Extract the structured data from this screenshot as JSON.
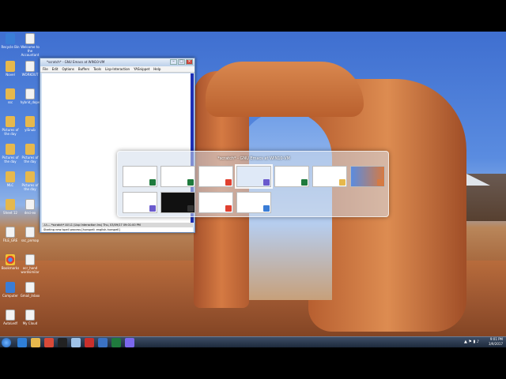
{
  "desktop": {
    "icons": [
      {
        "label": "Recycle Bin",
        "kind": "blue"
      },
      {
        "label": "Welcome to the\nAccountant",
        "kind": "doc"
      },
      {
        "label": "Novel",
        "kind": "folder"
      },
      {
        "label": "WORKOUT",
        "kind": "doc"
      },
      {
        "label": "ssc",
        "kind": "folder"
      },
      {
        "label": "hybrid_dope",
        "kind": "doc"
      },
      {
        "label": "Pictures of\nthe day",
        "kind": "folder"
      },
      {
        "label": "yiSnub",
        "kind": "folder"
      },
      {
        "label": "Pictures of\nthe day",
        "kind": "folder"
      },
      {
        "label": "Pictures of\nthe day",
        "kind": "folder"
      },
      {
        "label": "MLC",
        "kind": "folder"
      },
      {
        "label": "Pictures of\nthe day",
        "kind": "folder"
      },
      {
        "label": "Sheet 12",
        "kind": "folder"
      },
      {
        "label": "deci-ex",
        "kind": "doc"
      },
      {
        "label": "FILE_GRE",
        "kind": "doc"
      },
      {
        "label": "ssc_pnmap",
        "kind": "doc"
      },
      {
        "label": "Bookmarks",
        "kind": "chrome"
      },
      {
        "label": "ocr_hand\nwordsimilar",
        "kind": "doc"
      },
      {
        "label": "Computer",
        "kind": "blue"
      },
      {
        "label": "Gmail_Inbox",
        "kind": "doc"
      },
      {
        "label": "AutoLedf",
        "kind": "doc"
      },
      {
        "label": "My Cloud",
        "kind": "doc"
      }
    ]
  },
  "emacs": {
    "title": "*scratch* - GNU Emacs at WIN10-VM",
    "menu": [
      "File",
      "Edit",
      "Options",
      "Buffers",
      "Tools",
      "Lisp-Interaction",
      "YASnippet",
      "Help"
    ],
    "modeline": "-U:---  *scratch*   All L1   (Lisp Interaction Ins) Thu, 03/09/17 09:01:00 PM",
    "echo": "Starting new Ispell process [hunspell: english-hunspell]"
  },
  "switcher": {
    "title": "*scratch* - GNU Emacs at WIN10-VM",
    "thumbs": [
      {
        "name": "excel-window",
        "icon": "#1f7a3d"
      },
      {
        "name": "blank-doc-window",
        "icon": "#1f7a3d"
      },
      {
        "name": "chrome-window",
        "icon": "#e04030"
      },
      {
        "name": "emacs-window",
        "icon": "#6a5acd"
      },
      {
        "name": "excel-window-2",
        "icon": "#1f7a3d"
      },
      {
        "name": "explorer-window",
        "icon": "#e6b84d"
      },
      {
        "name": "desktop-window",
        "icon": "#d57a43"
      },
      {
        "name": "emacs-window-2",
        "icon": "#6a5acd"
      },
      {
        "name": "terminal-window",
        "icon": "#333333"
      },
      {
        "name": "chrome-window-2",
        "icon": "#e04030"
      },
      {
        "name": "notepad-window",
        "icon": "#3a7dd6"
      }
    ]
  },
  "taskbar": {
    "buttons": [
      {
        "name": "ie-button",
        "color": "#2f7fd8"
      },
      {
        "name": "explorer-button",
        "color": "#e6b84d"
      },
      {
        "name": "chrome-button",
        "color": "#d94a38"
      },
      {
        "name": "cmd-button",
        "color": "#222222"
      },
      {
        "name": "notepad-button",
        "color": "#9fc3e8"
      },
      {
        "name": "acrobat-button",
        "color": "#c9302c"
      },
      {
        "name": "vs-button",
        "color": "#3b72c4"
      },
      {
        "name": "excel-button",
        "color": "#1f7a3d"
      },
      {
        "name": "emacs-button",
        "color": "#7b68ee"
      }
    ],
    "time": "9:01 PM",
    "date": "3/9/2017",
    "tray_icons": "▲ ⚑ ▮ ♪"
  }
}
